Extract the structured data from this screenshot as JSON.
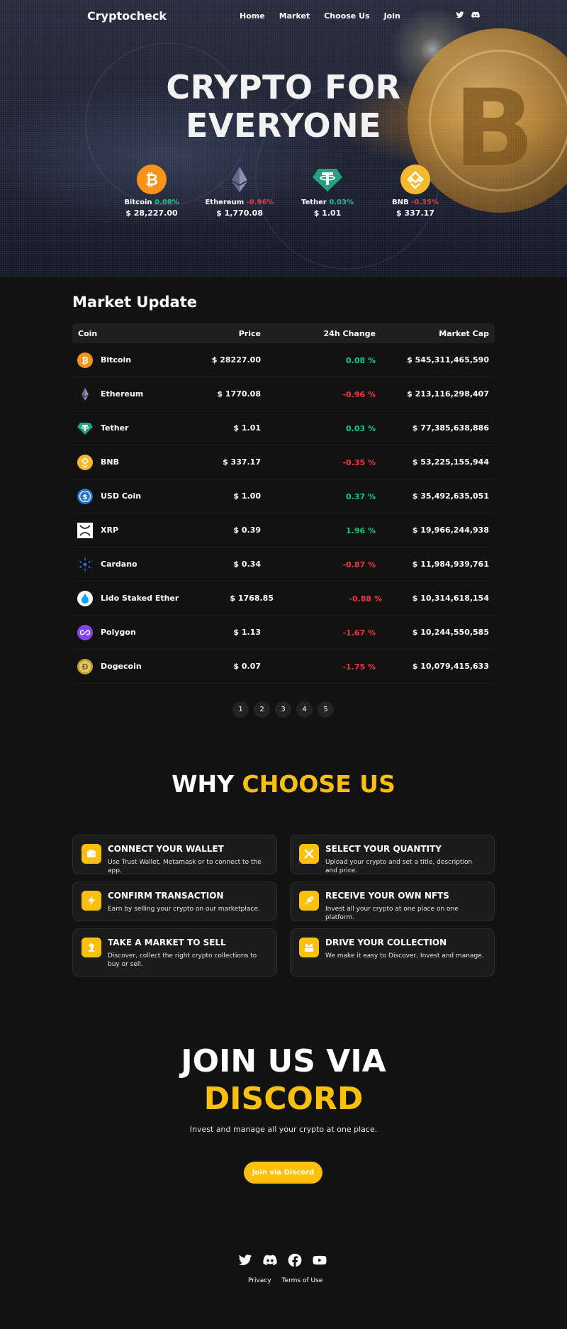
{
  "nav": {
    "logo": "Cryptocheck",
    "links": [
      "Home",
      "Market",
      "Choose Us",
      "Join"
    ],
    "social_icons": [
      "twitter-icon",
      "discord-icon"
    ]
  },
  "hero": {
    "title_line1": "CRYPTO FOR",
    "title_line2": "EVERYONE",
    "coins": [
      {
        "name": "Bitcoin",
        "change": "0.08%",
        "direction": "up",
        "price": "$ 28,227.00",
        "icon": "bitcoin-icon"
      },
      {
        "name": "Ethereum",
        "change": "-0.96%",
        "direction": "down",
        "price": "$ 1,770.08",
        "icon": "ethereum-icon"
      },
      {
        "name": "Tether",
        "change": "0.03%",
        "direction": "up",
        "price": "$ 1.01",
        "icon": "tether-icon"
      },
      {
        "name": "BNB",
        "change": "-0.35%",
        "direction": "down",
        "price": "$ 337.17",
        "icon": "bnb-icon"
      }
    ]
  },
  "market": {
    "title": "Market Update",
    "columns": {
      "coin": "Coin",
      "price": "Price",
      "change": "24h Change",
      "cap": "Market Cap"
    },
    "rows": [
      {
        "name": "Bitcoin",
        "price": "$ 28227.00",
        "change": "0.08 %",
        "direction": "up",
        "cap": "$ 545,311,465,590",
        "icon": "bitcoin-icon"
      },
      {
        "name": "Ethereum",
        "price": "$ 1770.08",
        "change": "-0.96 %",
        "direction": "down",
        "cap": "$ 213,116,298,407",
        "icon": "ethereum-icon"
      },
      {
        "name": "Tether",
        "price": "$ 1.01",
        "change": "0.03 %",
        "direction": "up",
        "cap": "$ 77,385,638,886",
        "icon": "tether-icon"
      },
      {
        "name": "BNB",
        "price": "$ 337.17",
        "change": "-0.35 %",
        "direction": "down",
        "cap": "$ 53,225,155,944",
        "icon": "bnb-icon"
      },
      {
        "name": "USD Coin",
        "price": "$ 1.00",
        "change": "0.37 %",
        "direction": "up",
        "cap": "$ 35,492,635,051",
        "icon": "usd-coin-icon"
      },
      {
        "name": "XRP",
        "price": "$ 0.39",
        "change": "1.96 %",
        "direction": "up",
        "cap": "$ 19,966,244,938",
        "icon": "xrp-icon"
      },
      {
        "name": "Cardano",
        "price": "$ 0.34",
        "change": "-0.87 %",
        "direction": "down",
        "cap": "$ 11,984,939,761",
        "icon": "cardano-icon"
      },
      {
        "name": "Lido Staked Ether",
        "price": "$ 1768.85",
        "change": "-0.88 %",
        "direction": "down",
        "cap": "$ 10,314,618,154",
        "icon": "lido-icon"
      },
      {
        "name": "Polygon",
        "price": "$ 1.13",
        "change": "-1.67 %",
        "direction": "down",
        "cap": "$ 10,244,550,585",
        "icon": "polygon-icon"
      },
      {
        "name": "Dogecoin",
        "price": "$ 0.07",
        "change": "-1.75 %",
        "direction": "down",
        "cap": "$ 10,079,415,633",
        "icon": "dogecoin-icon"
      }
    ],
    "pages": [
      "1",
      "2",
      "3",
      "4",
      "5"
    ]
  },
  "why": {
    "title_white": "WHY",
    "title_accent": "CHOOSE US",
    "cards": [
      {
        "title": "CONNECT YOUR WALLET",
        "desc": "Use Trust Wallet, Metamask or to connect to the app.",
        "icon": "wallet-icon"
      },
      {
        "title": "SELECT YOUR QUANTITY",
        "desc": "Upload your crypto and set a title, description and price.",
        "icon": "tools-icon"
      },
      {
        "title": "CONFIRM TRANSACTION",
        "desc": "Earn by selling your crypto on our marketplace.",
        "icon": "lightning-icon"
      },
      {
        "title": "RECEIVE YOUR OWN NFTS",
        "desc": "Invest all your crypto at one place on one platform.",
        "icon": "rocket-icon"
      },
      {
        "title": "TAKE A MARKET TO SELL",
        "desc": "Discover, collect the right crypto collections to buy or sell.",
        "icon": "horse-icon"
      },
      {
        "title": "DRIVE YOUR COLLECTION",
        "desc": "We make it easy to Discover, Invest and manage.",
        "icon": "collection-icon"
      }
    ]
  },
  "join": {
    "title_white": "JOIN US VIA",
    "title_accent": "DISCORD",
    "subtitle": "Invest and manage all your crypto at one place.",
    "button": "Join via Discord"
  },
  "footer": {
    "social_icons": [
      "twitter-icon",
      "discord-icon",
      "facebook-icon",
      "youtube-icon"
    ],
    "links": [
      "Privacy",
      "Terms of Use"
    ]
  },
  "colors": {
    "accent": "#fbbf0e",
    "up": "#16c784",
    "down": "#ea3943",
    "background": "#121212"
  }
}
